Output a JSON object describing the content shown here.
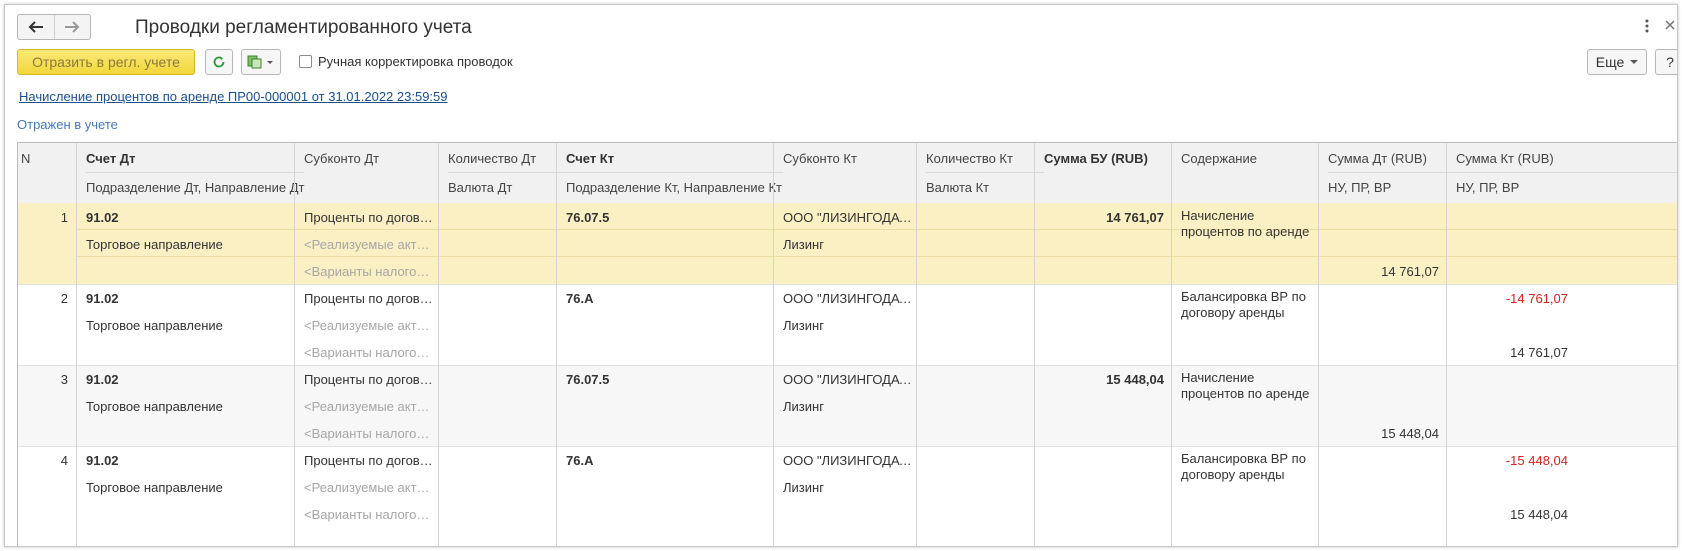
{
  "window": {
    "title": "Проводки регламентированного учета"
  },
  "toolbar": {
    "reflect_label": "Отразить в регл. учете",
    "manual_label": "Ручная корректировка проводок",
    "more_label": "Еще",
    "help_label": "?"
  },
  "document_link": "Начисление процентов по аренде ПР00-000001 от 31.01.2022 23:59:59",
  "status": "Отражен в учете",
  "columns": {
    "n": "N",
    "dt_account": "Счет Дт",
    "dt_subdivision": "Подразделение Дт, Направление Дт",
    "dt_subconto": "Субконто Дт",
    "dt_qty": "Количество Дт",
    "dt_currency": "Валюта Дт",
    "kt_account": "Счет Кт",
    "kt_subdivision": "Подразделение Кт, Направление Кт",
    "kt_subconto": "Субконто Кт",
    "kt_qty": "Количество Кт",
    "kt_currency": "Валюта Кт",
    "sum_bu": "Сумма БУ (RUB)",
    "content": "Содержание",
    "sum_dt": "Сумма Дт (RUB)",
    "sum_dt_sub": "НУ, ПР, ВР",
    "sum_kt": "Сумма Кт (RUB)",
    "sum_kt_sub": "НУ, ПР, ВР"
  },
  "rows": [
    {
      "n": "1",
      "dt_account": "91.02",
      "dt_direction": "Торговое направление",
      "dt_sub1": "Проценты по догово...",
      "dt_sub2": "<Реализуемые акти...",
      "dt_sub3": "<Варианты налогооб...",
      "kt_account": "76.07.5",
      "kt_sub1": "ООО \"ЛИЗИНГОДАТ...",
      "kt_sub2": "Лизинг",
      "sum_bu": "14 761,07",
      "content": "Начисление процентов по аренде",
      "sum_dt_row3": "14 761,07",
      "sum_kt_row1": "",
      "sum_kt_row3": ""
    },
    {
      "n": "2",
      "dt_account": "91.02",
      "dt_direction": "Торговое направление",
      "dt_sub1": "Проценты по догово...",
      "dt_sub2": "<Реализуемые акти...",
      "dt_sub3": "<Варианты налогооб...",
      "kt_account": "76.А",
      "kt_sub1": "ООО \"ЛИЗИНГОДАТ...",
      "kt_sub2": "Лизинг",
      "sum_bu": "",
      "content": "Балансировка ВР по договору аренды",
      "sum_dt_row3": "",
      "sum_kt_row1": "-14 761,07",
      "sum_kt_row3": "14 761,07"
    },
    {
      "n": "3",
      "dt_account": "91.02",
      "dt_direction": "Торговое направление",
      "dt_sub1": "Проценты по догово...",
      "dt_sub2": "<Реализуемые акти...",
      "dt_sub3": "<Варианты налогооб...",
      "kt_account": "76.07.5",
      "kt_sub1": "ООО \"ЛИЗИНГОДАТ...",
      "kt_sub2": "Лизинг",
      "sum_bu": "15 448,04",
      "content": "Начисление процентов по аренде",
      "sum_dt_row3": "15 448,04",
      "sum_kt_row1": "",
      "sum_kt_row3": ""
    },
    {
      "n": "4",
      "dt_account": "91.02",
      "dt_direction": "Торговое направление",
      "dt_sub1": "Проценты по догово...",
      "dt_sub2": "<Реализуемые акти...",
      "dt_sub3": "<Варианты налогооб...",
      "kt_account": "76.А",
      "kt_sub1": "ООО \"ЛИЗИНГОДАТ...",
      "kt_sub2": "Лизинг",
      "sum_bu": "",
      "content": "Балансировка ВР по договору аренды",
      "sum_dt_row3": "",
      "sum_kt_row1": "-15 448,04",
      "sum_kt_row3": "15 448,04"
    }
  ],
  "colors": {
    "selected_row": "#fbf0c3",
    "alt_row": "#f7f7f7",
    "accent_yellow": "#f3d63b",
    "negative": "#d12424"
  },
  "icons": [
    "back-arrow-icon",
    "forward-arrow-icon",
    "refresh-icon",
    "report-dropdown-icon",
    "kebab-menu-icon",
    "close-icon"
  ]
}
